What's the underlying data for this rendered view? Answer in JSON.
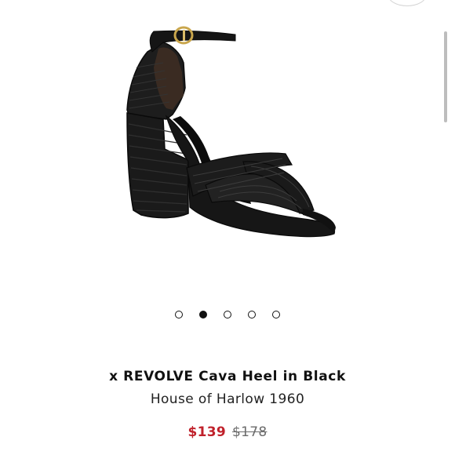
{
  "product": {
    "title": "x REVOLVE Cava Heel in Black",
    "brand": "House of Harlow 1960",
    "sale_price": "$139",
    "original_price": "$178",
    "image_icon": "black-block-heel-sandal-image"
  },
  "carousel": {
    "total_slides": 5,
    "active_index": 1
  },
  "colors": {
    "sale_price": "#c0212b",
    "original_price": "#6b6b6b",
    "text": "#111111"
  }
}
